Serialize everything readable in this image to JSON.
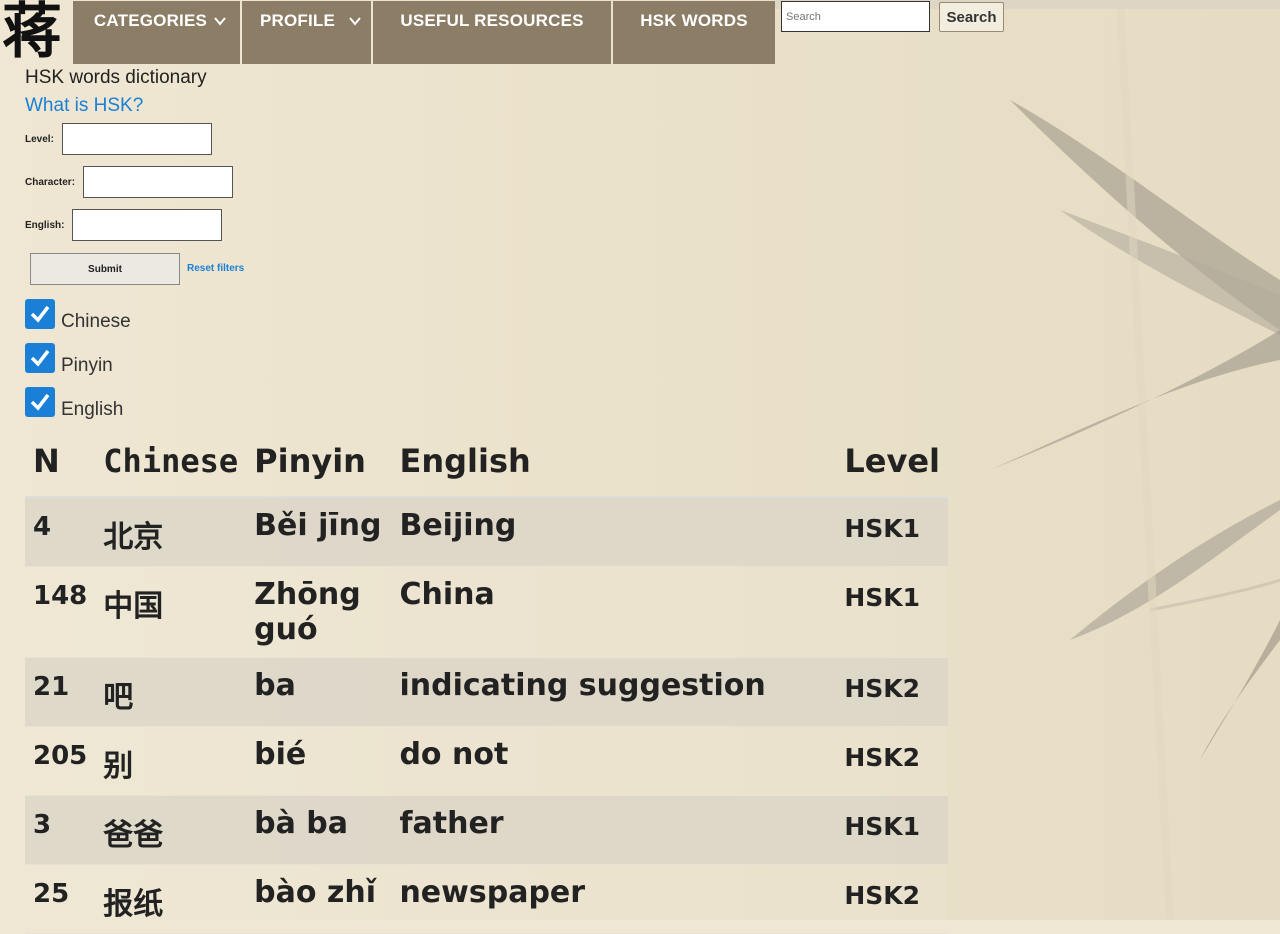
{
  "logo": {
    "glyph": "蒋"
  },
  "nav": {
    "categories": "CATEGORIES",
    "profile": "PROFILE",
    "resources": "USEFUL RESOURCES",
    "hsk_words": "HSK WORDS"
  },
  "search": {
    "placeholder": "Search",
    "button": "Search"
  },
  "page": {
    "title": "HSK words dictionary",
    "what_link": "What is HSK?"
  },
  "filters": {
    "level_label": "Level:",
    "character_label": "Character:",
    "english_label": "English:",
    "submit": "Submit",
    "reset": "Reset filters"
  },
  "columns_toggle": [
    {
      "label": "Chinese",
      "checked": true
    },
    {
      "label": "Pinyin",
      "checked": true
    },
    {
      "label": "English",
      "checked": true
    }
  ],
  "table": {
    "headers": [
      "N",
      "Chinese",
      "Pinyin",
      "English",
      "Level"
    ],
    "rows": [
      {
        "n": "4",
        "chinese": "北京",
        "pinyin": "Běi jīng",
        "english": "Beijing",
        "level": "HSK1"
      },
      {
        "n": "148",
        "chinese": "中国",
        "pinyin": "Zhōng guó",
        "english": "China",
        "level": "HSK1"
      },
      {
        "n": "21",
        "chinese": "吧",
        "pinyin": "ba",
        "english": "indicating suggestion",
        "level": "HSK2"
      },
      {
        "n": "205",
        "chinese": "别",
        "pinyin": "bié",
        "english": "do not",
        "level": "HSK2"
      },
      {
        "n": "3",
        "chinese": "爸爸",
        "pinyin": "bà ba",
        "english": "father",
        "level": "HSK1"
      },
      {
        "n": "25",
        "chinese": "报纸",
        "pinyin": "bào zhǐ",
        "english": "newspaper",
        "level": "HSK2"
      }
    ]
  },
  "colors": {
    "nav_bg": "#8c7d66",
    "link": "#1a7fd6",
    "checkbox": "#1a7fd6",
    "page_bg": "#efe7d3"
  }
}
